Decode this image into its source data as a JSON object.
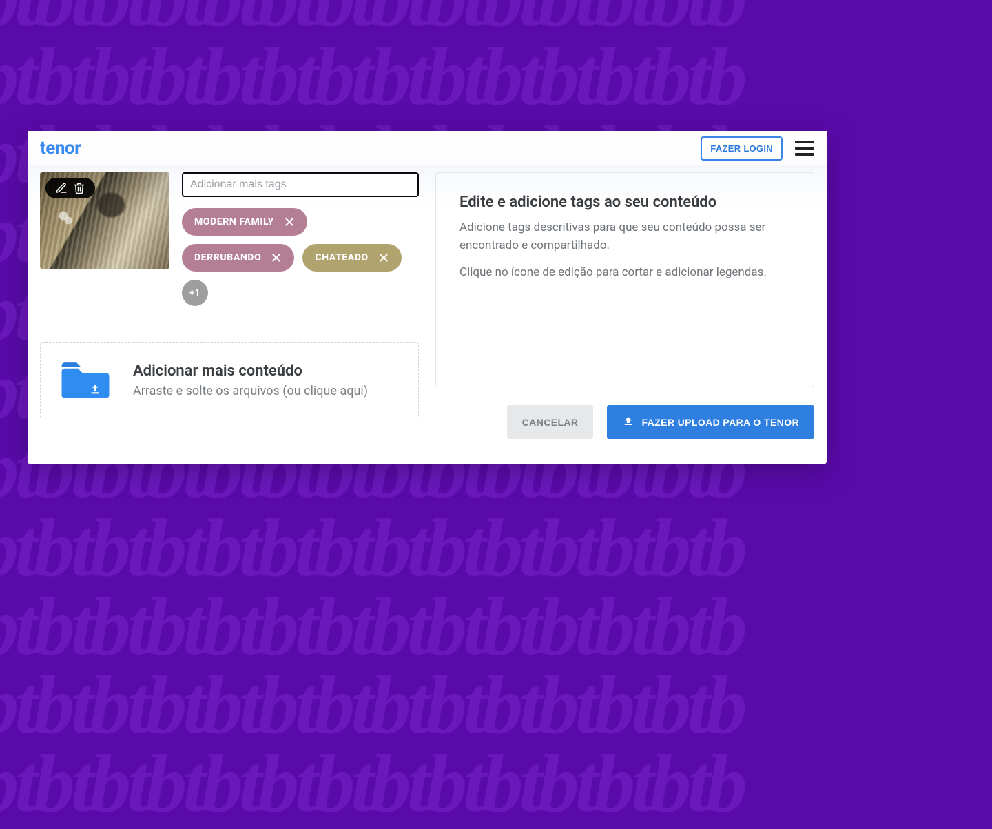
{
  "brand": {
    "logo": "tenor"
  },
  "header": {
    "login_label": "FAZER LOGIN"
  },
  "editor": {
    "tag_input_placeholder": "Adicionar mais tags",
    "tags": [
      {
        "label": "MODERN FAMILY",
        "color": "mauve",
        "removable": true
      },
      {
        "label": "DERRUBANDO",
        "color": "mauve",
        "removable": true
      },
      {
        "label": "CHATEADO",
        "color": "olive",
        "removable": true
      }
    ],
    "overflow_badge": "+1"
  },
  "info": {
    "title": "Edite e adicione tags ao seu conteúdo",
    "paragraph1": "Adicione tags descritivas para que seu conteúdo possa ser encontrado e compartilhado.",
    "paragraph2": "Clique no ícone de edição para cortar e adicionar legendas."
  },
  "dropzone": {
    "title": "Adicionar mais conteúdo",
    "subtitle": "Arraste e solte os arquivos (ou clique aqui)"
  },
  "footer": {
    "cancel_label": "CANCELAR",
    "upload_label": "FAZER UPLOAD PARA O TENOR"
  }
}
